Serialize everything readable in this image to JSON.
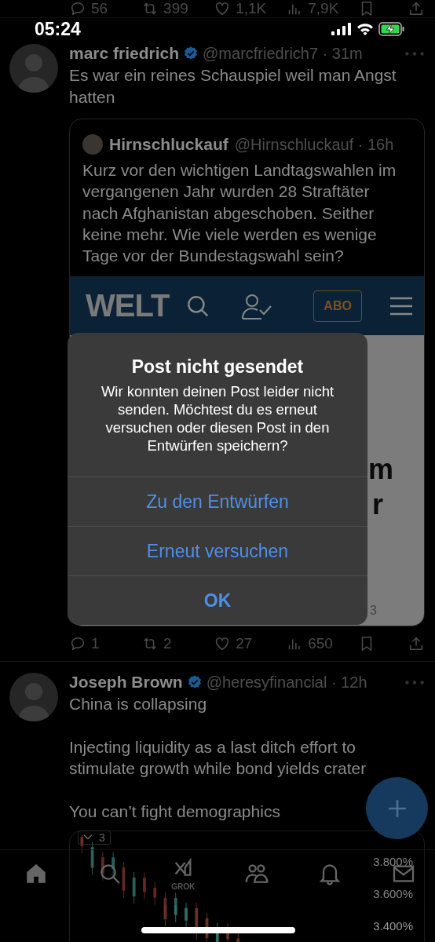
{
  "top_actions": [
    {
      "kind": "reply",
      "count": "56"
    },
    {
      "kind": "repost",
      "count": "399"
    },
    {
      "kind": "like",
      "count": "1,1K"
    },
    {
      "kind": "views",
      "count": "7,9K"
    },
    {
      "kind": "bookmark"
    },
    {
      "kind": "share"
    }
  ],
  "status_bar": {
    "time": "05:24"
  },
  "posts": [
    {
      "name": "marc friedrich",
      "verified": true,
      "meta": "@marcfriedrich7 · 31m",
      "paragraphs": [
        "Es war ein reines Schauspiel weil man Angst hatten"
      ],
      "quote": {
        "name": "Hirnschluckauf",
        "meta": "@Hirnschluckauf · 16h",
        "text": "Kurz vor den wichtigen Landtagswahlen im vergangenen Jahr wurden 28 Straftäter nach Afghanistan abgeschoben. Seither keine mehr. Wie viele werden es wenige Tage vor der Bundestagswahl sein?",
        "preview": {
          "logo": "WELT",
          "subscribe": "ABO",
          "fragments": [
            "m",
            "r",
            "3"
          ]
        }
      },
      "actions": [
        {
          "kind": "reply",
          "count": "1"
        },
        {
          "kind": "repost",
          "count": "2"
        },
        {
          "kind": "like",
          "count": "27"
        },
        {
          "kind": "views",
          "count": "650"
        },
        {
          "kind": "bookmark"
        },
        {
          "kind": "share"
        }
      ]
    },
    {
      "name": "Joseph Brown",
      "verified": true,
      "meta": "@heresyfinancial · 12h",
      "paragraphs": [
        "China is collapsing",
        "Injecting liquidity as a last ditch effort to stimulate growth while bond yields crater",
        "You can’t fight demographics"
      ],
      "chart": {
        "badge": "3",
        "y_labels": [
          "3.800%",
          "3.600%",
          "3.400%"
        ]
      }
    }
  ],
  "nav": [
    {
      "kind": "home",
      "selected": true
    },
    {
      "kind": "search",
      "selected": false
    },
    {
      "kind": "grok",
      "label": "GROK",
      "selected": false
    },
    {
      "kind": "communities",
      "selected": false
    },
    {
      "kind": "notifications",
      "selected": false
    },
    {
      "kind": "messages",
      "selected": false
    }
  ],
  "dialog": {
    "title": "Post nicht gesendet",
    "message": "Wir konnten deinen Post leider nicht senden. Möchtest du es erneut versuchen oder diesen Post in den Entwürfen speichern?",
    "buttons": [
      {
        "label": "Zu den Entwürfen",
        "bold": false
      },
      {
        "label": "Erneut versuchen",
        "bold": false
      },
      {
        "label": "OK",
        "bold": true
      }
    ]
  }
}
